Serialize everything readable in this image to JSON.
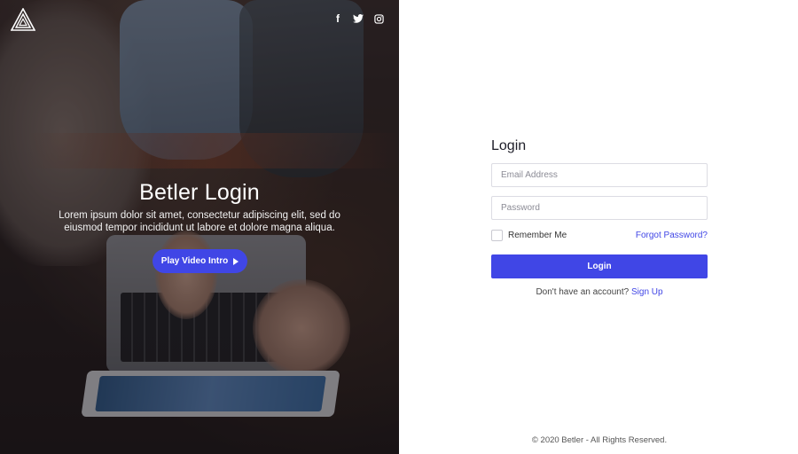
{
  "hero": {
    "title": "Betler Login",
    "text": "Lorem ipsum dolor sit amet, consectetur adipiscing elit, sed do eiusmod tempor incididunt ut labore et dolore magna aliqua.",
    "play_button_label": "Play Video Intro",
    "social": [
      "f",
      "twitter-icon",
      "instagram-icon"
    ]
  },
  "form": {
    "title": "Login",
    "email_placeholder": "Email Address",
    "password_placeholder": "Password",
    "remember_label": "Remember Me",
    "forgot_label": "Forgot Password?",
    "login_label": "Login",
    "no_account_text": "Don't have an account?",
    "signup_label": "Sign Up"
  },
  "footer": {
    "text": "© 2020 Betler - All Rights Reserved."
  },
  "colors": {
    "accent": "#4046e6",
    "text_dark": "#1d1d28"
  }
}
